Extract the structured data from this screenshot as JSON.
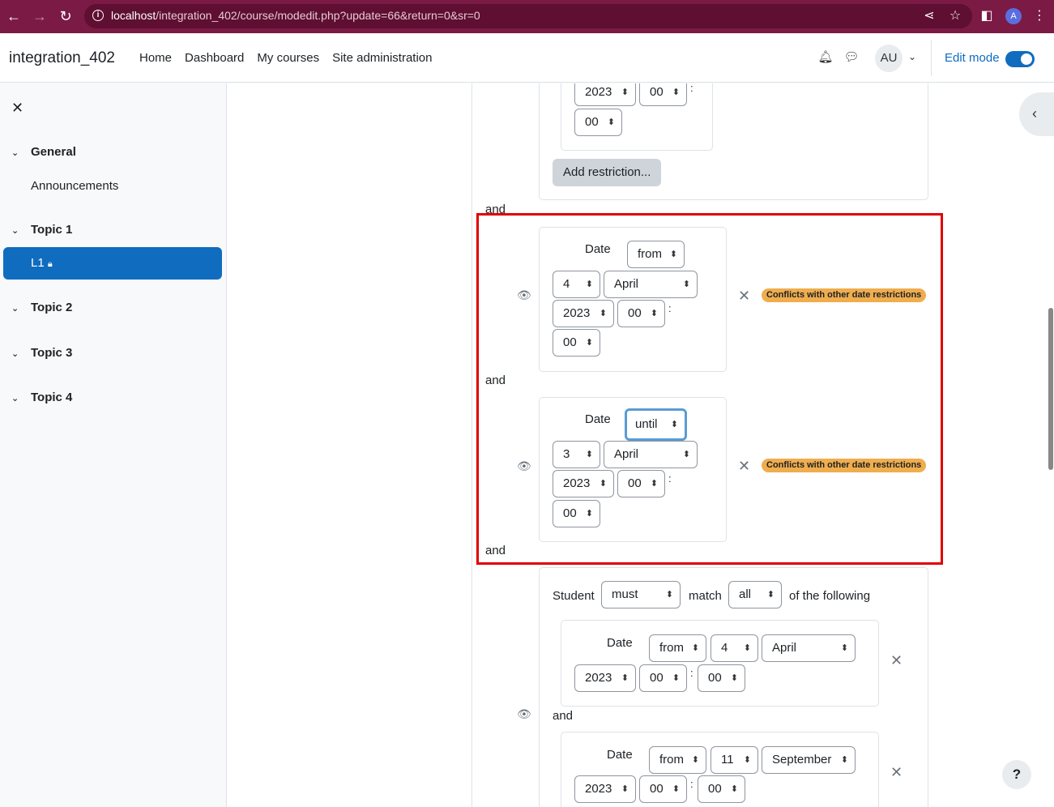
{
  "browser": {
    "url_host": "localhost",
    "url_path": "/integration_402/course/modedit.php?update=66&return=0&sr=0",
    "profile_initial": "A"
  },
  "navbar": {
    "brand": "integration_402",
    "links": [
      "Home",
      "Dashboard",
      "My courses",
      "Site administration"
    ],
    "avatar": "AU",
    "edit_mode_label": "Edit mode"
  },
  "drawer": {
    "sections": [
      {
        "title": "General",
        "items": [
          "Announcements"
        ]
      },
      {
        "title": "Topic 1",
        "items": [
          "L1"
        ]
      },
      {
        "title": "Topic 2",
        "items": []
      },
      {
        "title": "Topic 3",
        "items": []
      },
      {
        "title": "Topic 4",
        "items": []
      }
    ]
  },
  "top_partial": {
    "year": "2023",
    "hour": "00",
    "minute": "00",
    "add_restriction": "Add restriction..."
  },
  "connector": "and",
  "restrictions": [
    {
      "label": "Date",
      "direction": "from",
      "day": "4",
      "month": "April",
      "year": "2023",
      "hour": "00",
      "minute": "00",
      "badge": "Conflicts with other date restrictions"
    },
    {
      "label": "Date",
      "direction": "until",
      "day": "3",
      "month": "April",
      "year": "2023",
      "hour": "00",
      "minute": "00",
      "badge": "Conflicts with other date restrictions"
    }
  ],
  "nested_set": {
    "student": "Student",
    "must": "must",
    "match": "match",
    "all": "all",
    "of_following": "of the following",
    "dates": [
      {
        "label": "Date",
        "direction": "from",
        "day": "4",
        "month": "April",
        "year": "2023",
        "hour": "00",
        "minute": "00"
      },
      {
        "label": "Date",
        "direction": "from",
        "day": "11",
        "month": "September",
        "year": "2023",
        "hour": "00",
        "minute": "00"
      }
    ]
  },
  "help_label": "?"
}
